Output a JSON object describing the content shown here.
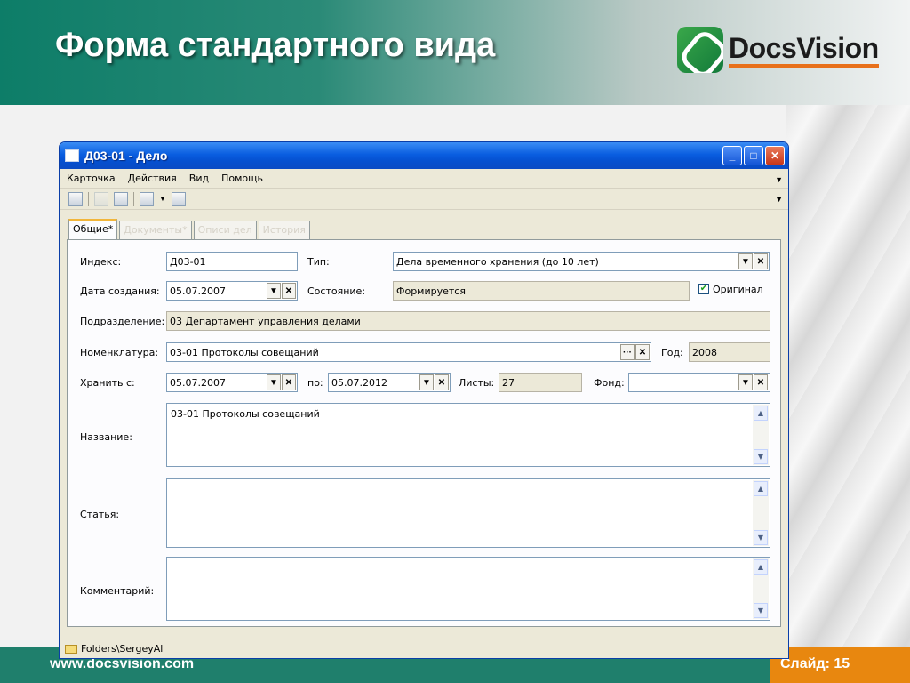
{
  "slide": {
    "title": "Форма стандартного вида",
    "logo_text": "DocsVision",
    "footer_url": "www.docsvision.com",
    "slide_number": "Слайд: 15"
  },
  "window": {
    "title": "Д03-01 - Дело",
    "buttons": {
      "minimize": "_",
      "maximize": "□",
      "close": "✕"
    }
  },
  "menu": [
    "Карточка",
    "Действия",
    "Вид",
    "Помощь"
  ],
  "tabs": [
    {
      "label": "Общие*",
      "active": true
    },
    {
      "label": "Документы*",
      "active": false
    },
    {
      "label": "Описи дел",
      "active": false
    },
    {
      "label": "История",
      "active": false
    }
  ],
  "form": {
    "index_label": "Индекс:",
    "index_value": "Д03-01",
    "type_label": "Тип:",
    "type_value": "Дела временного хранения (до 10 лет)",
    "created_label": "Дата создания:",
    "created_value": "05.07.2007",
    "state_label": "Состояние:",
    "state_value": "Формируется",
    "original_label": "Оригинал",
    "original_checked": true,
    "division_label": "Подразделение:",
    "division_value": "03 Департамент управления делами",
    "nomenclature_label": "Номенклатура:",
    "nomenclature_value": "03-01 Протоколы совещаний",
    "year_label": "Год:",
    "year_value": "2008",
    "keep_from_label": "Хранить с:",
    "keep_from_value": "05.07.2007",
    "keep_to_label": "по:",
    "keep_to_value": "05.07.2012",
    "sheets_label": "Листы:",
    "sheets_value": "27",
    "fund_label": "Фонд:",
    "fund_value": "",
    "name_label": "Название:",
    "name_value": "03-01 Протоколы совещаний",
    "article_label": "Статья:",
    "article_value": "",
    "comment_label": "Комментарий:",
    "comment_value": ""
  },
  "glyphs": {
    "dropdown": "▼",
    "clear": "✕",
    "ellipsis": "···",
    "check": "✔",
    "scroll_up": "▲",
    "scroll_down": "▼"
  },
  "status": {
    "path": "Folders\\SergeyAl"
  }
}
